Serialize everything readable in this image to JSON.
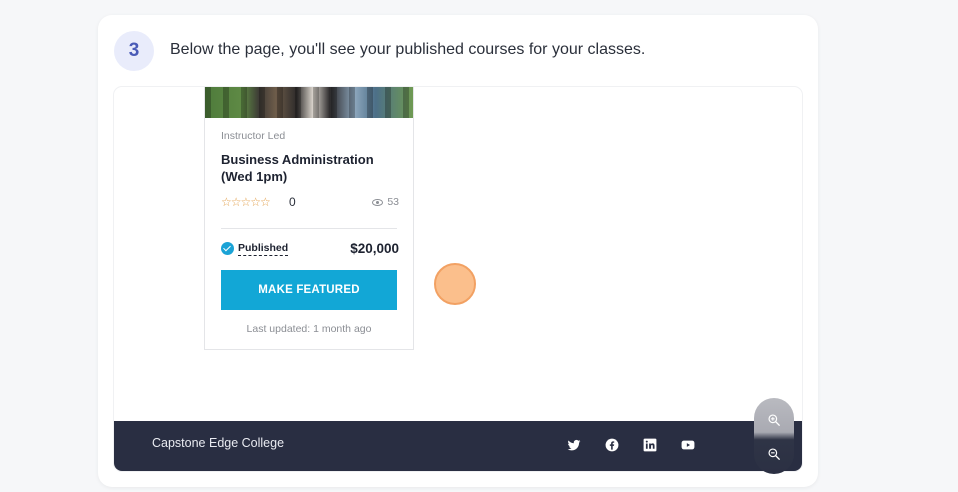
{
  "step": {
    "number": "3",
    "text": "Below the page, you'll see your published courses for your classes."
  },
  "course_card": {
    "type": "Instructor Led",
    "title": "Business Administration (Wed 1pm)",
    "stars": "☆☆☆☆☆",
    "rating_count": "0",
    "views": "53",
    "status": "Published",
    "price": "$20,000",
    "button_label": "MAKE FEATURED",
    "updated": "Last updated: 1 month ago"
  },
  "footer": {
    "college_name": "Capstone Edge College",
    "social_icons": [
      "twitter-icon",
      "facebook-icon",
      "linkedin-icon",
      "youtube-icon"
    ]
  },
  "zoom_controls": [
    "zoom-in-icon",
    "zoom-out-icon"
  ],
  "colors": {
    "accent": "#12a7d6",
    "footer_bg": "#292e42",
    "cursor": "#fbbf8c",
    "step_badge": "#4a5bb7"
  }
}
